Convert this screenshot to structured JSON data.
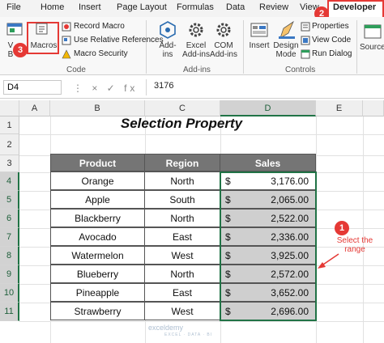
{
  "ribbon_tabs": [
    "File",
    "Home",
    "Insert",
    "Page Layout",
    "Formulas",
    "Data",
    "Review",
    "View",
    "Developer"
  ],
  "code_group": {
    "visual_basic": "V\nB",
    "macros": "Macros",
    "record_macro": "Record Macro",
    "relative_refs": "Use Relative References",
    "macro_security": "Macro Security",
    "label": "Code"
  },
  "addins_group": {
    "addins": "Add-\nins",
    "excel_addins": "Excel\nAdd-ins",
    "com_addins": "COM\nAdd-ins",
    "label": "Add-ins"
  },
  "controls_group": {
    "insert": "Insert",
    "design_mode": "Design\nMode",
    "properties": "Properties",
    "view_code": "View Code",
    "run_dialog": "Run Dialog",
    "label": "Controls"
  },
  "source": "Source",
  "callouts": {
    "one": "1",
    "two": "2",
    "three": "3"
  },
  "formula_bar": {
    "name_box": "D4",
    "fx": "⋮ × ✓ fx",
    "value": "3176"
  },
  "columns": [
    "A",
    "B",
    "C",
    "D",
    "E"
  ],
  "rows": [
    "1",
    "2",
    "3",
    "4",
    "5",
    "6",
    "7",
    "8",
    "9",
    "10",
    "11"
  ],
  "sheet_title": "Selection Property",
  "table": {
    "headers": [
      "Product",
      "Region",
      "Sales"
    ],
    "rows": [
      {
        "product": "Orange",
        "region": "North",
        "currency": "$",
        "sales": "3,176.00"
      },
      {
        "product": "Apple",
        "region": "South",
        "currency": "$",
        "sales": "2,065.00"
      },
      {
        "product": "Blackberry",
        "region": "North",
        "currency": "$",
        "sales": "2,522.00"
      },
      {
        "product": "Avocado",
        "region": "East",
        "currency": "$",
        "sales": "2,336.00"
      },
      {
        "product": "Watermelon",
        "region": "West",
        "currency": "$",
        "sales": "3,925.00"
      },
      {
        "product": "Blueberry",
        "region": "North",
        "currency": "$",
        "sales": "2,572.00"
      },
      {
        "product": "Pineapple",
        "region": "East",
        "currency": "$",
        "sales": "3,652.00"
      },
      {
        "product": "Strawberry",
        "region": "West",
        "currency": "$",
        "sales": "2,696.00"
      }
    ]
  },
  "annotation": "Select the\nrange",
  "watermark": "exceldemy",
  "watermark_sub": "EXCEL · DATA · BI",
  "colors": {
    "accent_red": "#e53935",
    "excel_green": "#217346",
    "header_gray": "#757575",
    "selection_gray": "#cfcfcf"
  }
}
